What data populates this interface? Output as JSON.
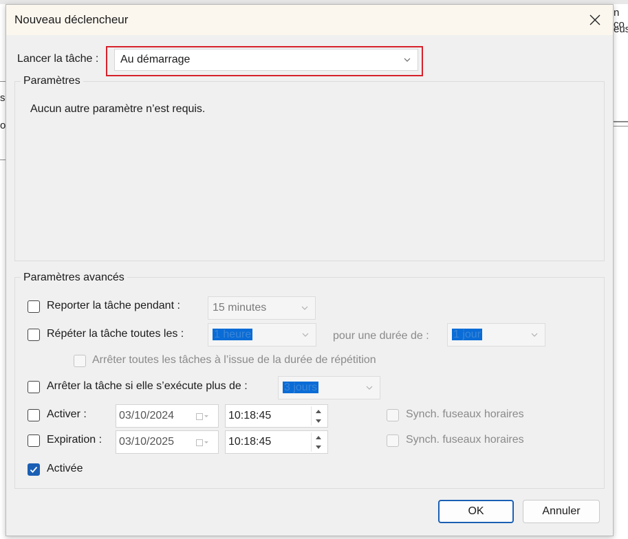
{
  "background": {
    "fragments": [
      "s",
      "o",
      "n co",
      "eus"
    ]
  },
  "dialog": {
    "title": "Nouveau déclencheur",
    "close_label": "✕"
  },
  "launch": {
    "label": "Lancer la tâche :",
    "value": "Au démarrage"
  },
  "settings": {
    "title": "Paramètres",
    "message": "Aucun autre paramètre n’est requis."
  },
  "advanced": {
    "title": "Paramètres avancés",
    "delay": {
      "label": "Reporter la tâche pendant :",
      "value": "15 minutes",
      "checked": false
    },
    "repeat": {
      "label": "Répéter la tâche toutes les :",
      "value": "1 heure",
      "duration_label": "pour une durée de :",
      "duration_value": "1 jour",
      "checked": false
    },
    "stop_all": {
      "label": "Arrêter toutes les tâches à l’issue de la durée de répétition",
      "checked": false
    },
    "stop_if": {
      "label": "Arrêter la tâche si elle s’exécute plus de :",
      "value": "3 jours",
      "checked": false
    },
    "activate": {
      "label": "Activer :",
      "date": "03/10/2024",
      "time": "10:18:45",
      "sync_label": "Synch. fuseaux horaires",
      "checked": false
    },
    "expiration": {
      "label": "Expiration :",
      "date": "03/10/2025",
      "time": "10:18:45",
      "sync_label": "Synch. fuseaux horaires",
      "checked": false
    },
    "enabled": {
      "label": "Activée",
      "checked": true
    }
  },
  "buttons": {
    "ok": "OK",
    "cancel": "Annuler"
  },
  "colors": {
    "highlight_frame": "#d6202a",
    "accent": "#1a5fb4",
    "selection": "#0a6cd6"
  }
}
